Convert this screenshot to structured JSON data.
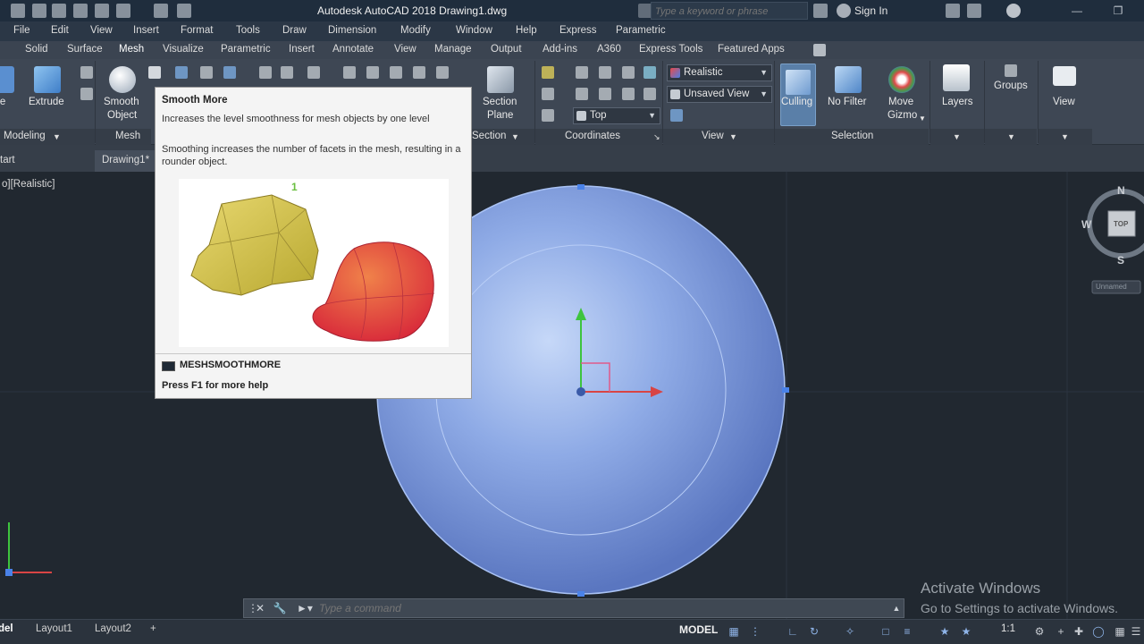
{
  "titlebar": {
    "app_title": "Autodesk AutoCAD 2018    Drawing1.dwg",
    "search_placeholder": "Type a keyword or phrase",
    "signin_label": "Sign In"
  },
  "menubar": {
    "items": [
      "File",
      "Edit",
      "View",
      "Insert",
      "Format",
      "Tools",
      "Draw",
      "Dimension",
      "Modify",
      "Window",
      "Help",
      "Express",
      "Parametric"
    ]
  },
  "ribbon_tabs": {
    "items": [
      "Solid",
      "Surface",
      "Mesh",
      "Visualize",
      "Parametric",
      "Insert",
      "Annotate",
      "View",
      "Manage",
      "Output",
      "Add-ins",
      "A360",
      "Express Tools",
      "Featured Apps"
    ]
  },
  "ribbon": {
    "extrude_label": "Extrude",
    "smooth_object_line1": "Smooth",
    "smooth_object_line2": "Object",
    "section_plane_line1": "Section",
    "section_plane_line2": "Plane",
    "visual_style_value": "Realistic",
    "view_value": "Unsaved View",
    "ucs_value": "Top",
    "culling_label": "Culling",
    "no_filter_label": "No Filter",
    "move_gizmo_line1": "Move",
    "move_gizmo_line2": "Gizmo",
    "layers_label": "Layers",
    "groups_label": "Groups",
    "view_label": "View",
    "panel_modeling": "Modeling",
    "panel_mesh": "Mesh",
    "panel_section": "Section",
    "panel_coordinates": "Coordinates",
    "panel_view": "View",
    "panel_selection": "Selection"
  },
  "filetabs": {
    "start_label": "tart",
    "drawing_label": "Drawing1*"
  },
  "viewport": {
    "view_label": "o][Realistic]",
    "viewcube_top": "TOP",
    "viewcube_n": "N",
    "viewcube_s": "S",
    "viewcube_w": "W",
    "wcs_label": "Unnamed",
    "watermark_title": "Activate Windows",
    "watermark_sub": "Go to Settings to activate Windows."
  },
  "tooltip": {
    "title": "Smooth More",
    "description": "Increases the level smoothness for mesh objects by one level",
    "detail": "Smoothing increases the number of facets in the mesh, resulting in a rounder object.",
    "image_badge": "1",
    "command": "MESHSMOOTHMORE",
    "help": "Press F1 for more help"
  },
  "cmdline": {
    "placeholder": "Type a command"
  },
  "statusbar": {
    "model_tab": "del",
    "layout1": "Layout1",
    "layout2": "Layout2",
    "add_tab": "+",
    "model_button": "MODEL",
    "scale": "1:1"
  },
  "colors": {
    "accent": "#5a7fa8",
    "sphere": "#7f9ee8",
    "titlebar": "#1f2d3d"
  }
}
